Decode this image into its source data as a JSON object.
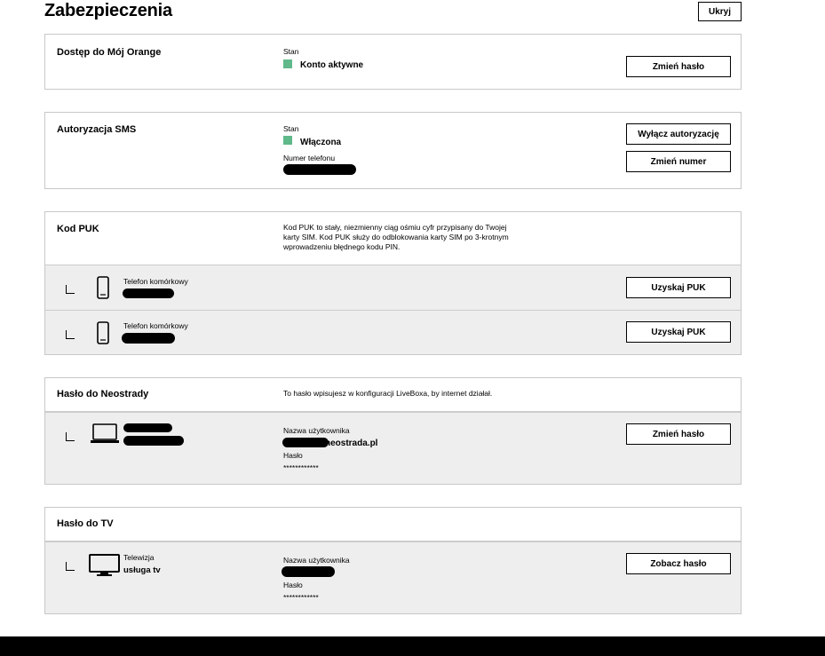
{
  "page": {
    "title": "Zabezpieczenia",
    "hide_label": "Ukryj"
  },
  "moj_orange": {
    "title": "Dostęp do Mój Orange",
    "status_label": "Stan",
    "status_value": "Konto aktywne",
    "status_color": "#5fb98a",
    "button": "Zmień hasło"
  },
  "sms": {
    "title": "Autoryzacja SMS",
    "status_label": "Stan",
    "status_value": "Włączona",
    "status_color": "#5fb98a",
    "phone_label": "Numer telefonu",
    "button_disable": "Wyłącz autoryzację",
    "button_change": "Zmień numer"
  },
  "puk": {
    "title": "Kod PUK",
    "description": "Kod PUK to stały, niezmienny ciąg ośmiu cyfr przypisany do Twojej karty SIM. Kod PUK służy do odblokowania karty SIM po 3-krotnym wprowadzeniu błędnego kodu PIN.",
    "rows": [
      {
        "device_label": "Telefon komórkowy",
        "icon": "mobile-phone-icon",
        "button": "Uzyskaj PUK"
      },
      {
        "device_label": "Telefon komórkowy",
        "icon": "mobile-phone-icon",
        "button": "Uzyskaj PUK"
      }
    ]
  },
  "neostrada": {
    "title": "Hasło do Neostrady",
    "description": "To hasło wpisujesz w konfiguracji LiveBoxa, by internet działał.",
    "icon": "laptop-icon",
    "username_label": "Nazwa użytkownika",
    "username_suffix": "neostrada.pl",
    "password_label": "Hasło",
    "password_value": "************",
    "button": "Zmień hasło"
  },
  "tv": {
    "title": "Hasło do TV",
    "icon": "tv-icon",
    "device_label": "Telewizja",
    "device_value": "usługa tv",
    "username_label": "Nazwa użytkownika",
    "password_label": "Hasło",
    "password_value": "************",
    "button": "Zobacz hasło"
  }
}
